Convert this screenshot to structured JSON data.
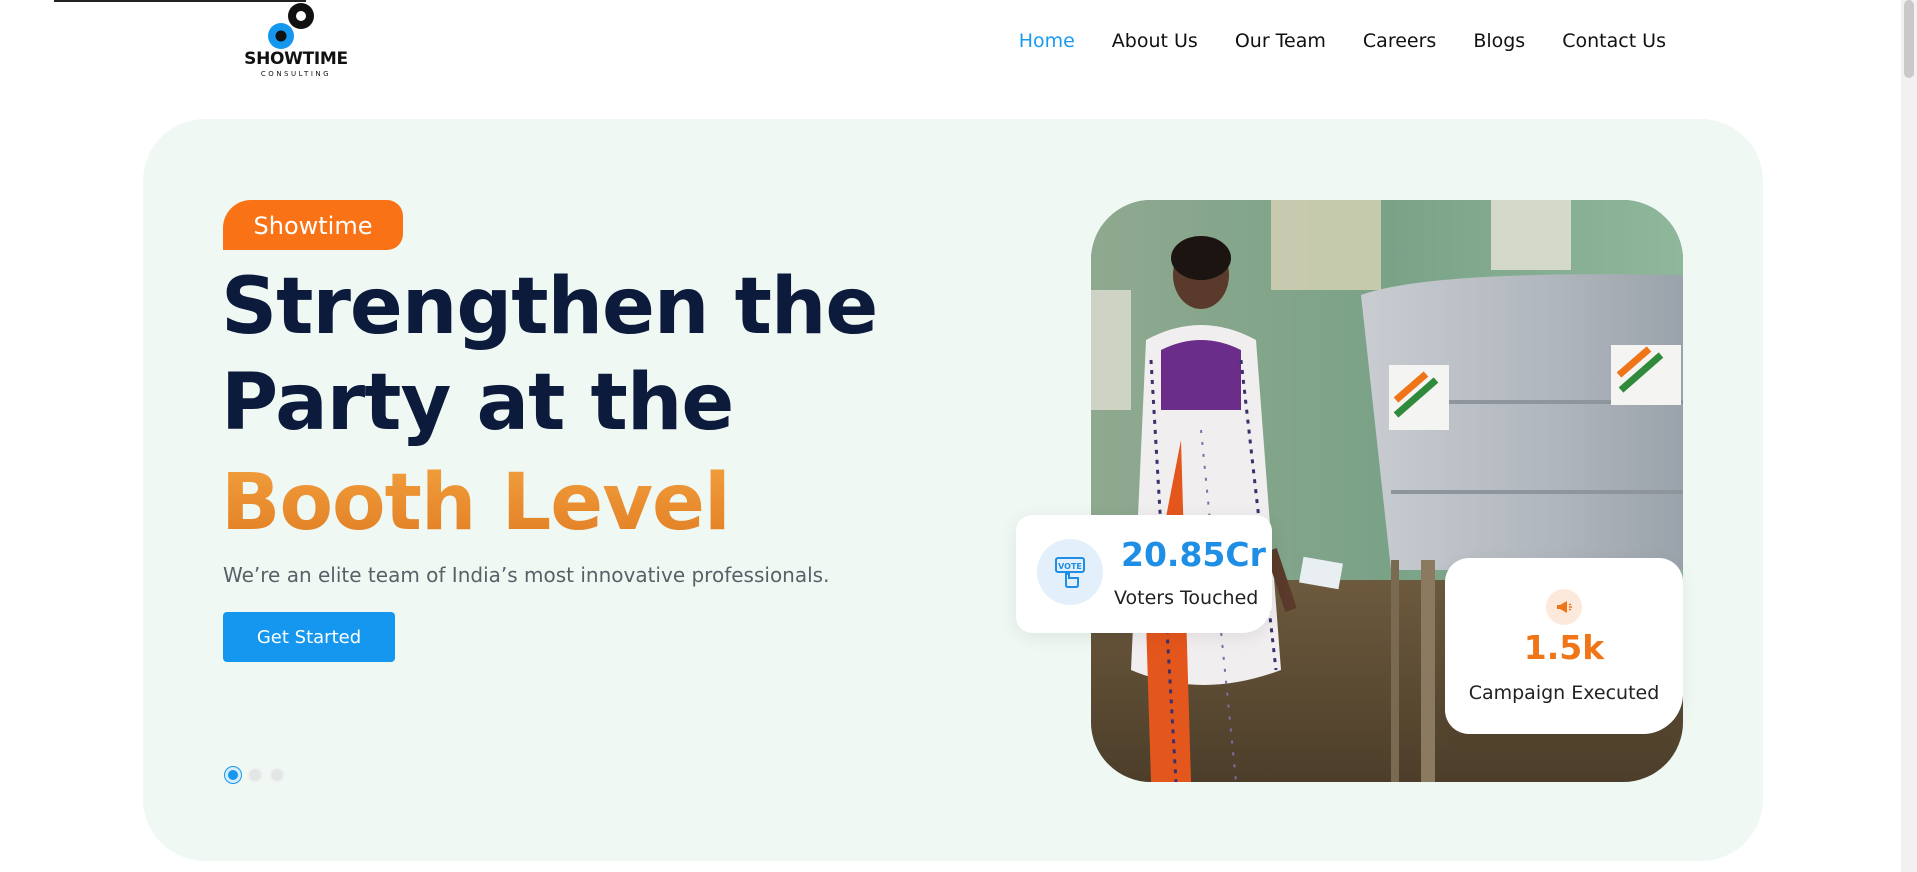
{
  "brand": {
    "name": "SHOWTIME",
    "tagline": "CONSULTING"
  },
  "nav": {
    "items": [
      {
        "label": "Home",
        "active": true
      },
      {
        "label": "About Us",
        "active": false
      },
      {
        "label": "Our Team",
        "active": false
      },
      {
        "label": "Careers",
        "active": false
      },
      {
        "label": "Blogs",
        "active": false
      },
      {
        "label": "Contact Us",
        "active": false
      }
    ]
  },
  "hero": {
    "badge": "Showtime",
    "headline_line1": "Strengthen the",
    "headline_line2": "Party at the",
    "headline_accent": "Booth Level",
    "subtext": "We’re an elite team of India’s most innovative professionals.",
    "cta_label": "Get Started",
    "slides": {
      "count": 3,
      "active_index": 0
    }
  },
  "stats": [
    {
      "value": "20.85Cr",
      "label": "Voters Touched",
      "icon": "vote-icon"
    },
    {
      "value": "1.5k",
      "label": "Campaign Executed",
      "icon": "megaphone-icon"
    }
  ],
  "colors": {
    "accent_blue": "#1597ef",
    "accent_orange": "#f97316",
    "headline_navy": "#0c1a3c",
    "hero_bg": "#eff8f3"
  }
}
